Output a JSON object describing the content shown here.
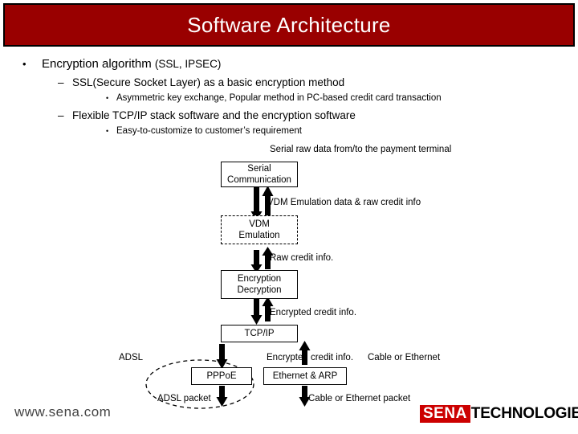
{
  "title": "Software Architecture",
  "bullets": {
    "level1": {
      "marker": "•",
      "text_main": "Encryption algorithm ",
      "text_small": "(SSL, IPSEC)"
    },
    "level2_a": {
      "marker": "–",
      "text": "SSL(Secure Socket Layer) as a basic encryption method"
    },
    "level3_a": {
      "marker": "•",
      "text": "Asymmetric key exchange, Popular method in PC-based credit card transaction"
    },
    "level2_b": {
      "marker": "–",
      "text": "Flexible TCP/IP stack software and the encryption software"
    },
    "level3_b": {
      "marker": "•",
      "text": "Easy-to-customize to customer’s requirement"
    }
  },
  "diagram": {
    "labels": {
      "serial_raw": "Serial raw data from/to the payment terminal",
      "vdm_emulation_data": "VDM Emulation data & raw credit info",
      "raw_credit": "Raw credit info.",
      "encrypted_credit_1": "Encrypted credit info.",
      "adsl": "ADSL",
      "encrypted_credit_2": "Encrypted credit info.",
      "cable_or_ethernet": "Cable or Ethernet",
      "adsl_packet": "ADSL packet",
      "cable_ethernet_packet": "Cable or Ethernet packet"
    },
    "boxes": {
      "serial_communication": "Serial\nCommunication",
      "serial_communication_l1": "Serial",
      "serial_communication_l2": "Communication",
      "vdm_emulation_l1": "VDM",
      "vdm_emulation_l2": "Emulation",
      "encryption_l1": "Encryption",
      "encryption_l2": "Decryption",
      "tcpip": "TCP/IP",
      "pppoe": "PPPoE",
      "ethernet_arp": "Ethernet & ARP"
    }
  },
  "footer": {
    "url": "www.sena.com",
    "logo_primary": "SENA",
    "logo_secondary": "TECHNOLOGIES"
  },
  "colors": {
    "title_bar": "#990000",
    "logo_red": "#cc0000",
    "text": "#000000"
  }
}
